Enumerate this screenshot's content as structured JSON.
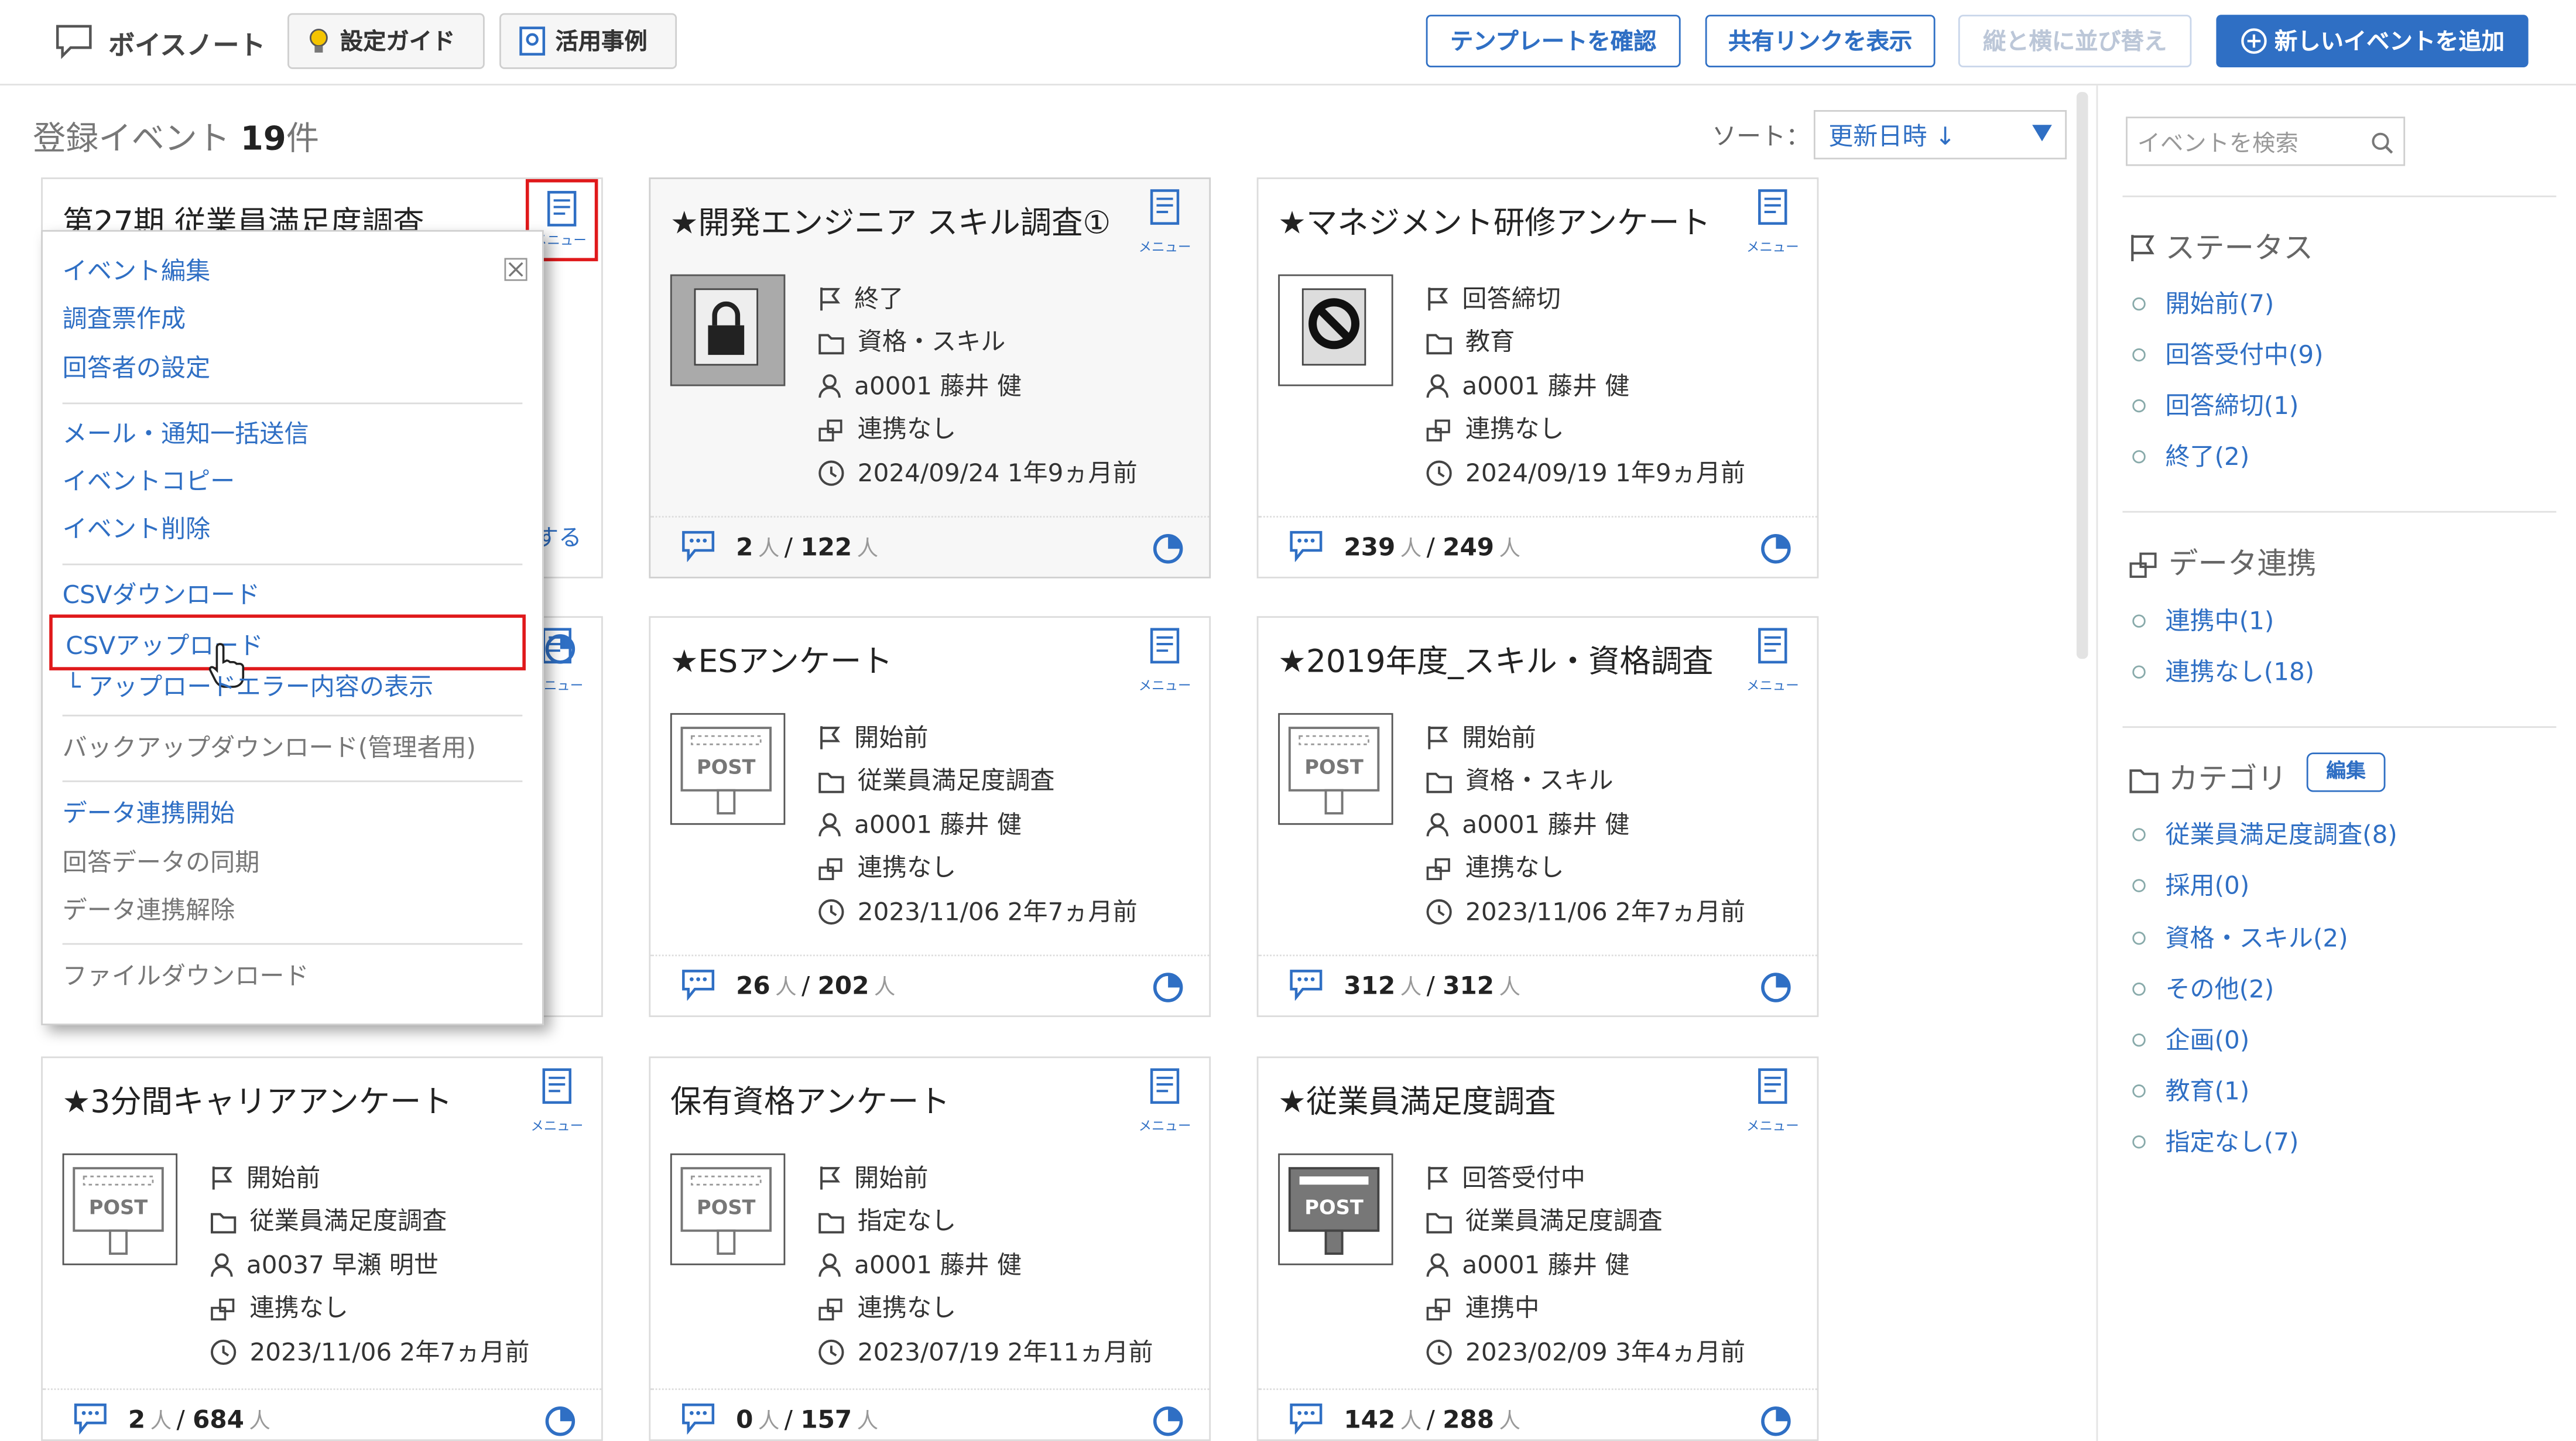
{
  "app": {
    "title": "ボイスノート"
  },
  "header": {
    "setup_guide": "設定ガイド",
    "cases": "活用事例",
    "template_btn": "テンプレートを確認",
    "share_btn": "共有リンクを表示",
    "reorder_btn": "縦と横に並び替え",
    "add_btn": "新しいイベントを追加"
  },
  "summary": {
    "prefix": "登録イベント",
    "count": "19",
    "suffix": "件"
  },
  "sort": {
    "label": "ソート：",
    "value": "更新日時 ↓"
  },
  "menu_label": "メニュー",
  "cards": [
    {
      "title": "第27期 従業員満足度調査",
      "foot_partial": "する"
    },
    {
      "title": "★開発エンジニア スキル調査①",
      "status": "終了",
      "category": "資格・スキル",
      "owner": "a0001 藤井 健",
      "link": "連携なし",
      "date": "2024/09/24 1年9ヵ月前",
      "answered": "2",
      "total": "122",
      "unit": "人",
      "thumb": "lock"
    },
    {
      "title": "★マネジメント研修アンケート",
      "status": "回答締切",
      "category": "教育",
      "owner": "a0001 藤井 健",
      "link": "連携なし",
      "date": "2024/09/19 1年9ヵ月前",
      "answered": "239",
      "total": "249",
      "unit": "人",
      "thumb": "no"
    },
    {
      "title": "",
      "status": "",
      "category": "",
      "owner": "",
      "link": "",
      "date": ""
    },
    {
      "title": "★ESアンケート",
      "status": "開始前",
      "category": "従業員満足度調査",
      "owner": "a0001 藤井 健",
      "link": "連携なし",
      "date": "2023/11/06 2年7ヵ月前",
      "answered": "26",
      "total": "202",
      "unit": "人",
      "thumb": "post"
    },
    {
      "title": "★2019年度_スキル・資格調査",
      "status": "開始前",
      "category": "資格・スキル",
      "owner": "a0001 藤井 健",
      "link": "連携なし",
      "date": "2023/11/06 2年7ヵ月前",
      "answered": "312",
      "total": "312",
      "unit": "人",
      "thumb": "post"
    },
    {
      "title": "★3分間キャリアアンケート",
      "status": "開始前",
      "category": "従業員満足度調査",
      "owner": "a0037 早瀬 明世",
      "link": "連携なし",
      "date": "2023/11/06 2年7ヵ月前",
      "answered": "2",
      "total": "684",
      "unit": "人",
      "thumb": "post"
    },
    {
      "title": "保有資格アンケート",
      "status": "開始前",
      "category": "指定なし",
      "owner": "a0001 藤井 健",
      "link": "連携なし",
      "date": "2023/07/19 2年11ヵ月前",
      "answered": "0",
      "total": "157",
      "unit": "人",
      "thumb": "post"
    },
    {
      "title": "★従業員満足度調査",
      "status": "回答受付中",
      "category": "従業員満足度調査",
      "owner": "a0001 藤井 健",
      "link": "連携中",
      "date": "2023/02/09 3年4ヵ月前",
      "answered": "142",
      "total": "288",
      "unit": "人",
      "thumb": "post-dark"
    }
  ],
  "dropdown": {
    "items": [
      "イベント編集",
      "調査票作成",
      "回答者の設定",
      "メール・通知一括送信",
      "イベントコピー",
      "イベント削除",
      "CSVダウンロード",
      "CSVアップロード",
      "└ アップロードエラー内容の表示",
      "バックアップダウンロード(管理者用)",
      "データ連携開始",
      "回答データの同期",
      "データ連携解除",
      "ファイルダウンロード"
    ]
  },
  "sidebar": {
    "search_placeholder": "イベントを検索",
    "status_title": "ステータス",
    "status_items": [
      "開始前(7)",
      "回答受付中(9)",
      "回答締切(1)",
      "終了(2)"
    ],
    "link_title": "データ連携",
    "link_items": [
      "連携中(1)",
      "連携なし(18)"
    ],
    "category_title": "カテゴリ",
    "category_edit": "編集",
    "category_items": [
      "従業員満足度調査(8)",
      "採用(0)",
      "資格・スキル(2)",
      "その他(2)",
      "企画(0)",
      "教育(1)",
      "指定なし(7)"
    ]
  },
  "colors": {
    "accent": "#2f6fc4",
    "highlight": "#e0191b"
  }
}
